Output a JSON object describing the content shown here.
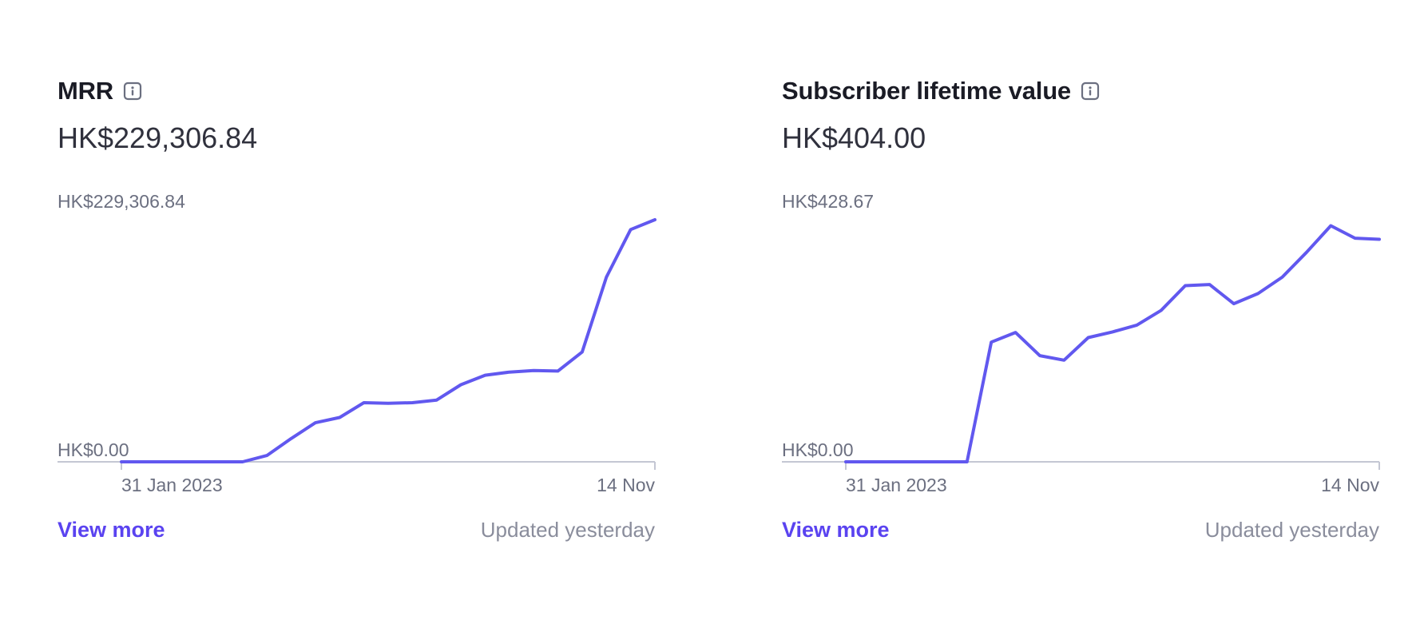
{
  "colors": {
    "line": "#6158ef",
    "axis": "#c4c7d3",
    "label": "#6b6f80",
    "link": "#5a43f0"
  },
  "icons": {
    "info": "info-icon"
  },
  "cards": [
    {
      "title": "MRR",
      "amount": "HK$229,306.84",
      "view_more": "View more",
      "updated": "Updated yesterday"
    },
    {
      "title": "Subscriber lifetime value",
      "amount": "HK$404.00",
      "view_more": "View more",
      "updated": "Updated yesterday"
    }
  ],
  "chart_data": [
    {
      "type": "line",
      "title": "MRR",
      "y_max_label": "HK$229,306.84",
      "y_min_label": "HK$0.00",
      "x_start_label": "31 Jan 2023",
      "x_end_label": "14 Nov",
      "ylim": [
        0,
        229306.84
      ],
      "grid": false,
      "values": [
        0,
        0,
        0,
        0,
        0,
        0,
        6000,
        22000,
        37000,
        42000,
        56000,
        55500,
        56000,
        58500,
        73000,
        82000,
        85000,
        86500,
        86000,
        104000,
        175000,
        220000,
        229306.84
      ]
    },
    {
      "type": "line",
      "title": "Subscriber lifetime value",
      "y_max_label": "HK$428.67",
      "y_min_label": "HK$0.00",
      "x_start_label": "31 Jan 2023",
      "x_end_label": "14 Nov",
      "ylim": [
        0,
        428.67
      ],
      "grid": false,
      "values": [
        0,
        0,
        0,
        0,
        0,
        0,
        212,
        229,
        188,
        180,
        220,
        230,
        242,
        268,
        312,
        314,
        280,
        298,
        327,
        371,
        418,
        396,
        394
      ]
    }
  ]
}
